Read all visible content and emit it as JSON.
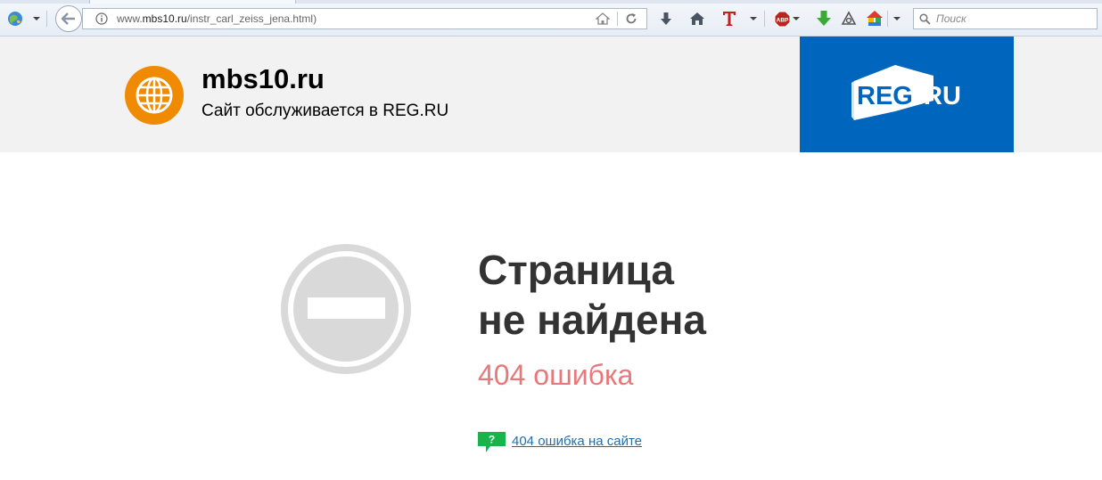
{
  "browser": {
    "url_prefix": "www.",
    "url_host": "mbs10.ru",
    "url_path": "/instr_carl_zeiss_jena.html)",
    "search_placeholder": "Поиск",
    "abp_badge": "ABP",
    "icons": [
      "globe-icon",
      "back-arrow-icon",
      "info-icon",
      "page-home-icon",
      "reload-icon",
      "download-arrow-icon",
      "home-icon",
      "t-icon",
      "adblock-icon",
      "green-download-icon",
      "target-icon",
      "colored-house-icon",
      "menu-dropdown-icon",
      "search-icon"
    ]
  },
  "header": {
    "site_name": "mbs10.ru",
    "tagline": "Сайт обслуживается в REG.RU",
    "reg_logo_text": "REG",
    "reg_logo_suffix": ".RU",
    "colors": {
      "header_bg": "#f2f2f2",
      "reg_blue": "#0065bd",
      "logo_orange": "#f08a00"
    }
  },
  "main": {
    "title_line1": "Страница",
    "title_line2": "не найдена",
    "error_label": "404 ошибка",
    "help_icon_text": "?",
    "help_link": "404 ошибка на сайте",
    "colors": {
      "title": "#333333",
      "error": "#e8787a",
      "link": "#1f6fb0",
      "help_icon": "#19b34b",
      "forbidden": "#d9d9d9"
    }
  }
}
